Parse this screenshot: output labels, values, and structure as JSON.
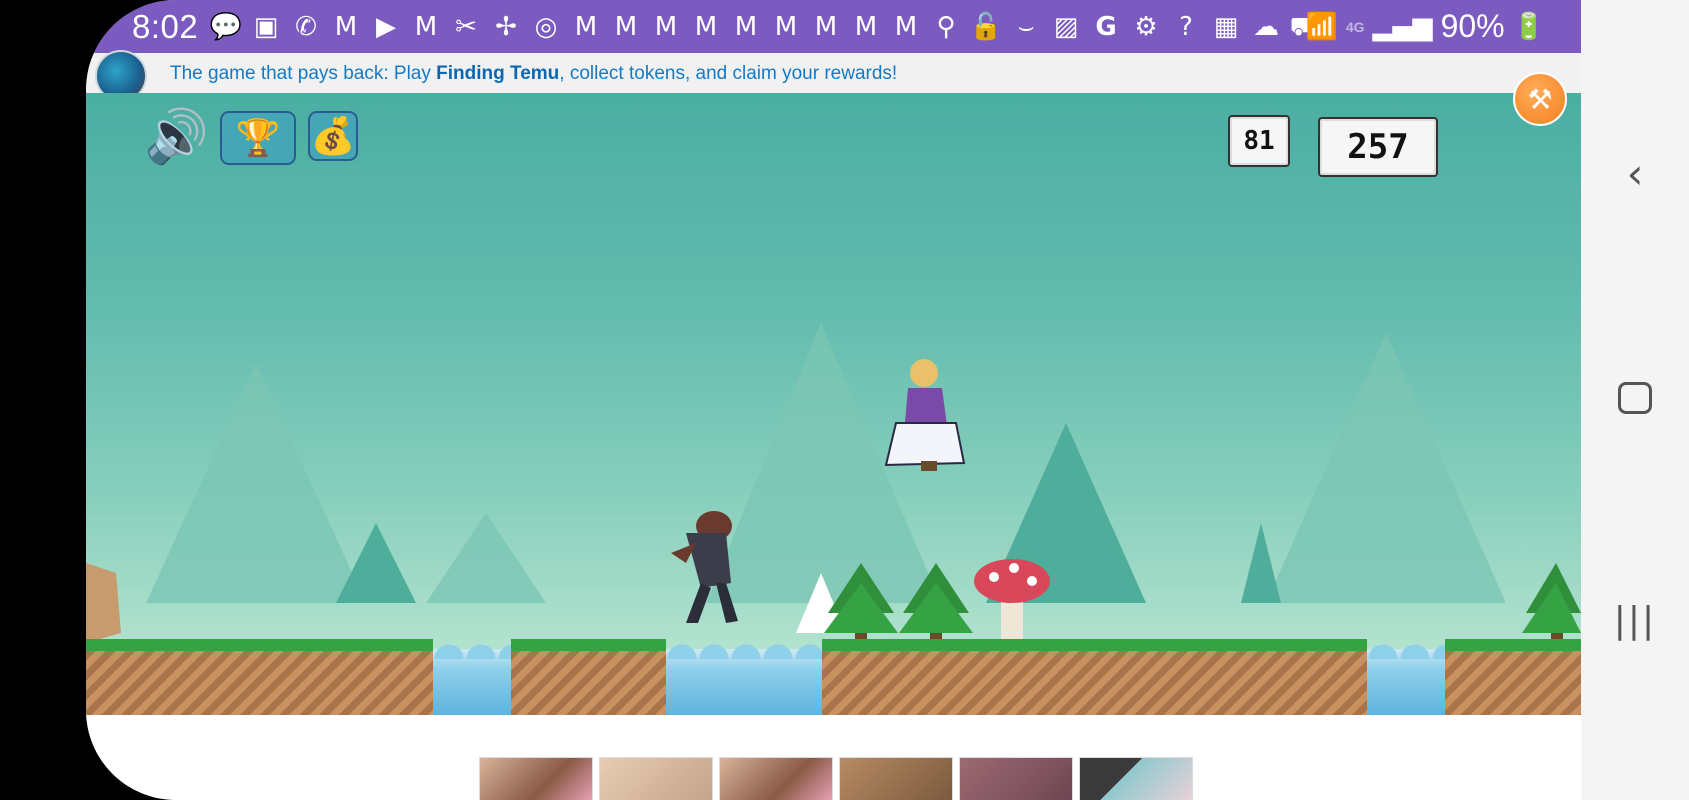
{
  "status_bar": {
    "time": "8:02",
    "battery": "90%",
    "network": "4G",
    "icons": [
      "chat-bubble-icon",
      "sim-icon",
      "messenger-icon",
      "gmail-icon",
      "youtube-icon",
      "gmail-icon",
      "tool-icon",
      "pinwheel-icon",
      "sync-icon",
      "gmail-icon",
      "gmail-icon",
      "gmail-icon",
      "gmail-icon",
      "gmail-icon",
      "gmail-icon",
      "gmail-icon",
      "gmail-icon",
      "gmail-icon",
      "location-icon",
      "lock-icon",
      "amazon-icon",
      "image-icon",
      "g-icon",
      "settings-icon",
      "help-icon",
      "calendar-icon",
      "cloud-icon",
      "truck-icon"
    ]
  },
  "banner": {
    "prefix": "The game that pays back: Play ",
    "bold": "Finding Temu",
    "suffix": ", collect tokens, and claim your rewards!"
  },
  "hud": {
    "sound_icon": "speaker-icon",
    "trophy_icon": "trophy-icon",
    "money_icon": "money-bag-icon",
    "coins": "81",
    "score": "257",
    "tools_icon": "tools-icon"
  },
  "colors": {
    "status_bar": "#7b5bbf",
    "banner_text": "#1679c4",
    "sky_top": "#4aaea2",
    "grass": "#35a243",
    "dirt": "#b7804f",
    "water": "#7cc5e6"
  },
  "nav": {
    "back_icon": "back-icon",
    "home_icon": "home-icon",
    "recents_icon": "recents-icon"
  }
}
